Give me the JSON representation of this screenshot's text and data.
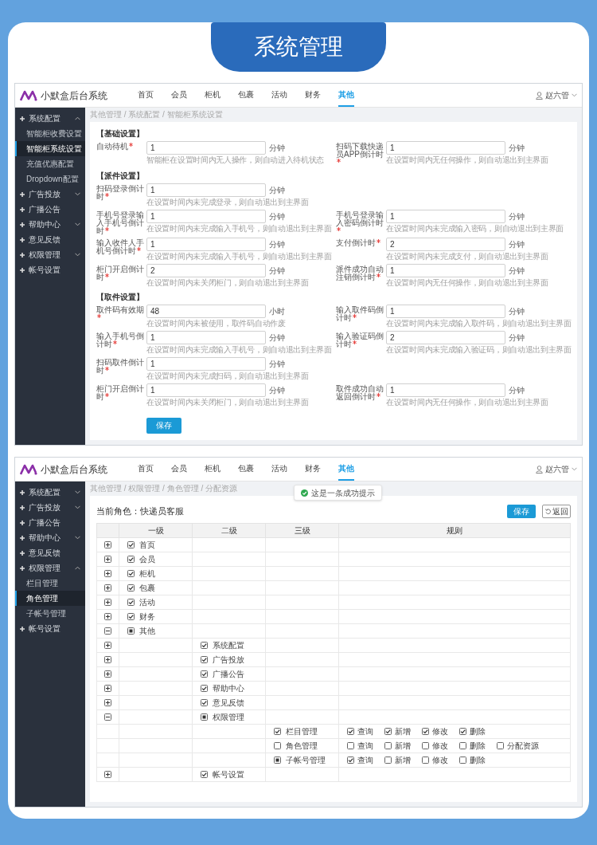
{
  "heading": "系统管理",
  "settings_screen": {
    "app_title": "小默盒后台系统",
    "nav": [
      {
        "label": "首页",
        "selected": false
      },
      {
        "label": "会员",
        "selected": false
      },
      {
        "label": "柜机",
        "selected": false
      },
      {
        "label": "包裹",
        "selected": false
      },
      {
        "label": "活动",
        "selected": false
      },
      {
        "label": "财务",
        "selected": false
      },
      {
        "label": "其他",
        "selected": true
      }
    ],
    "user": "赵六管",
    "sidebar": [
      {
        "label": "系统配置",
        "expanded": true,
        "children": [
          {
            "label": "智能柜收费设置",
            "selected": false
          },
          {
            "label": "智能柜系统设置",
            "selected": true
          },
          {
            "label": "充值优惠配置",
            "selected": false
          },
          {
            "label": "Dropdown配置",
            "selected": false
          }
        ]
      },
      {
        "label": "广告投放",
        "expanded": false
      },
      {
        "label": "广播公告"
      },
      {
        "label": "帮助中心",
        "expanded": false
      },
      {
        "label": "意见反馈"
      },
      {
        "label": "权限管理",
        "expanded": false
      },
      {
        "label": "帐号设置"
      }
    ],
    "breadcrumb": "其他管理 / 系统配置 / 智能柜系统设置",
    "sections": [
      {
        "title": "【基础设置】",
        "rows": [
          [
            {
              "label": "自动待机",
              "required": true,
              "value": "1",
              "unit": "分钟",
              "hint": "智能柜在设置时间内无人操作，则自动进入待机状态"
            },
            {
              "label": "扫码下载快递员APP倒计时",
              "required": true,
              "value": "1",
              "unit": "分钟",
              "hint": "在设置时间内无任何操作，则自动退出到主界面"
            }
          ]
        ]
      },
      {
        "title": "【派件设置】",
        "rows": [
          [
            {
              "label": "扫码登录倒计时",
              "required": true,
              "value": "1",
              "unit": "分钟",
              "hint": "在设置时间内未完成登录，则自动退出到主界面"
            }
          ],
          [
            {
              "label": "手机号登录输入手机号倒计时",
              "required": true,
              "value": "1",
              "unit": "分钟",
              "hint": "在设置时间内未完成输入手机号，则自动退出到主界面"
            },
            {
              "label": "手机号登录输入密码倒计时",
              "required": true,
              "value": "1",
              "unit": "分钟",
              "hint": "在设置时间内未完成输入密码，则自动退出到主界面"
            }
          ],
          [
            {
              "label": "输入收件人手机号倒计时",
              "required": true,
              "value": "1",
              "unit": "分钟",
              "hint": "在设置时间内未完成输入手机号，则自动退出到主界面"
            },
            {
              "label": "支付倒计时",
              "required": true,
              "value": "2",
              "unit": "分钟",
              "hint": "在设置时间内未完成支付，则自动退出到主界面"
            }
          ],
          [
            {
              "label": "柜门开启倒计时",
              "required": true,
              "value": "2",
              "unit": "分钟",
              "hint": "在设置时间内未关闭柜门，则自动退出到主界面"
            },
            {
              "label": "派件成功自动注销倒计时",
              "required": true,
              "value": "1",
              "unit": "分钟",
              "hint": "在设置时间内无任何操作，则自动退出到主界面"
            }
          ]
        ]
      },
      {
        "title": "【取件设置】",
        "rows": [
          [
            {
              "label": "取件码有效期",
              "required": true,
              "value": "48",
              "unit": "小时",
              "hint": "在设置时间内未被使用，取件码自动作废"
            },
            {
              "label": "输入取件码倒计时",
              "required": true,
              "value": "1",
              "unit": "分钟",
              "hint": "在设置时间内未完成输入取件码，则自动退出到主界面"
            }
          ],
          [
            {
              "label": "输入手机号倒计时",
              "required": true,
              "value": "1",
              "unit": "分钟",
              "hint": "在设置时间内未完成输入手机号，则自动退出到主界面"
            },
            {
              "label": "输入验证码倒计时",
              "required": true,
              "value": "2",
              "unit": "分钟",
              "hint": "在设置时间内未完成输入验证码，则自动退出到主界面"
            }
          ],
          [
            {
              "label": "扫码取件倒计时",
              "required": true,
              "value": "1",
              "unit": "分钟",
              "hint": "在设置时间内未完成扫码，则自动退出到主界面"
            }
          ],
          [
            {
              "label": "柜门开启倒计时",
              "required": true,
              "value": "1",
              "unit": "分钟",
              "hint": "在设置时间内未关闭柜门，则自动退出到主界面"
            },
            {
              "label": "取件成功自动返回倒计时",
              "required": true,
              "value": "1",
              "unit": "分钟",
              "hint": "在设置时间内无任何操作，则自动退出到主界面"
            }
          ]
        ]
      }
    ],
    "save_button": "保存"
  },
  "permissions_screen": {
    "app_title": "小默盒后台系统",
    "nav": [
      {
        "label": "首页",
        "selected": false
      },
      {
        "label": "会员",
        "selected": false
      },
      {
        "label": "柜机",
        "selected": false
      },
      {
        "label": "包裹",
        "selected": false
      },
      {
        "label": "活动",
        "selected": false
      },
      {
        "label": "财务",
        "selected": false
      },
      {
        "label": "其他",
        "selected": true
      }
    ],
    "user": "赵六管",
    "sidebar": [
      {
        "label": "系统配置",
        "expanded": false
      },
      {
        "label": "广告投放",
        "expanded": false
      },
      {
        "label": "广播公告"
      },
      {
        "label": "帮助中心",
        "expanded": false
      },
      {
        "label": "意见反馈"
      },
      {
        "label": "权限管理",
        "expanded": true,
        "children": [
          {
            "label": "栏目管理",
            "selected": false
          },
          {
            "label": "角色管理",
            "selected": true
          },
          {
            "label": "子帐号管理",
            "selected": false
          }
        ]
      },
      {
        "label": "帐号设置"
      }
    ],
    "breadcrumb": "其他管理 / 权限管理 / 角色管理 / 分配资源",
    "toast": "这是一条成功提示",
    "role_label": "当前角色：快递员客服",
    "save_button": "保存",
    "back_button": "返回",
    "columns": [
      "一级",
      "二级",
      "三级",
      "规则"
    ],
    "tree": [
      {
        "label": "首页",
        "checked": true,
        "partial": false,
        "expanded": false
      },
      {
        "label": "会员",
        "checked": true,
        "partial": false,
        "expanded": false
      },
      {
        "label": "柜机",
        "checked": true,
        "partial": false,
        "expanded": false
      },
      {
        "label": "包裹",
        "checked": true,
        "partial": false,
        "expanded": false
      },
      {
        "label": "活动",
        "checked": true,
        "partial": false,
        "expanded": false
      },
      {
        "label": "财务",
        "checked": true,
        "partial": false,
        "expanded": false
      },
      {
        "label": "其他",
        "checked": false,
        "partial": true,
        "expanded": true,
        "children": [
          {
            "label": "系统配置",
            "checked": true,
            "partial": false,
            "expanded": false
          },
          {
            "label": "广告投放",
            "checked": true,
            "partial": false,
            "expanded": false
          },
          {
            "label": "广播公告",
            "checked": true,
            "partial": false,
            "expanded": false
          },
          {
            "label": "帮助中心",
            "checked": true,
            "partial": false,
            "expanded": false
          },
          {
            "label": "意见反馈",
            "checked": true,
            "partial": false,
            "expanded": false
          },
          {
            "label": "权限管理",
            "checked": false,
            "partial": true,
            "expanded": true,
            "children": [
              {
                "label": "栏目管理",
                "checked": true,
                "partial": false,
                "rules": [
                  {
                    "label": "查询",
                    "checked": true
                  },
                  {
                    "label": "新增",
                    "checked": true
                  },
                  {
                    "label": "修改",
                    "checked": true
                  },
                  {
                    "label": "删除",
                    "checked": true
                  }
                ]
              },
              {
                "label": "角色管理",
                "checked": false,
                "partial": false,
                "rules": [
                  {
                    "label": "查询",
                    "checked": false
                  },
                  {
                    "label": "新增",
                    "checked": false
                  },
                  {
                    "label": "修改",
                    "checked": false
                  },
                  {
                    "label": "删除",
                    "checked": false
                  },
                  {
                    "label": "分配资源",
                    "checked": false
                  }
                ]
              },
              {
                "label": "子帐号管理",
                "checked": false,
                "partial": true,
                "rules": [
                  {
                    "label": "查询",
                    "checked": true
                  },
                  {
                    "label": "新增",
                    "checked": false
                  },
                  {
                    "label": "修改",
                    "checked": false
                  },
                  {
                    "label": "删除",
                    "checked": false
                  }
                ]
              }
            ]
          },
          {
            "label": "帐号设置",
            "checked": true,
            "partial": false,
            "expanded": false
          }
        ]
      }
    ]
  }
}
